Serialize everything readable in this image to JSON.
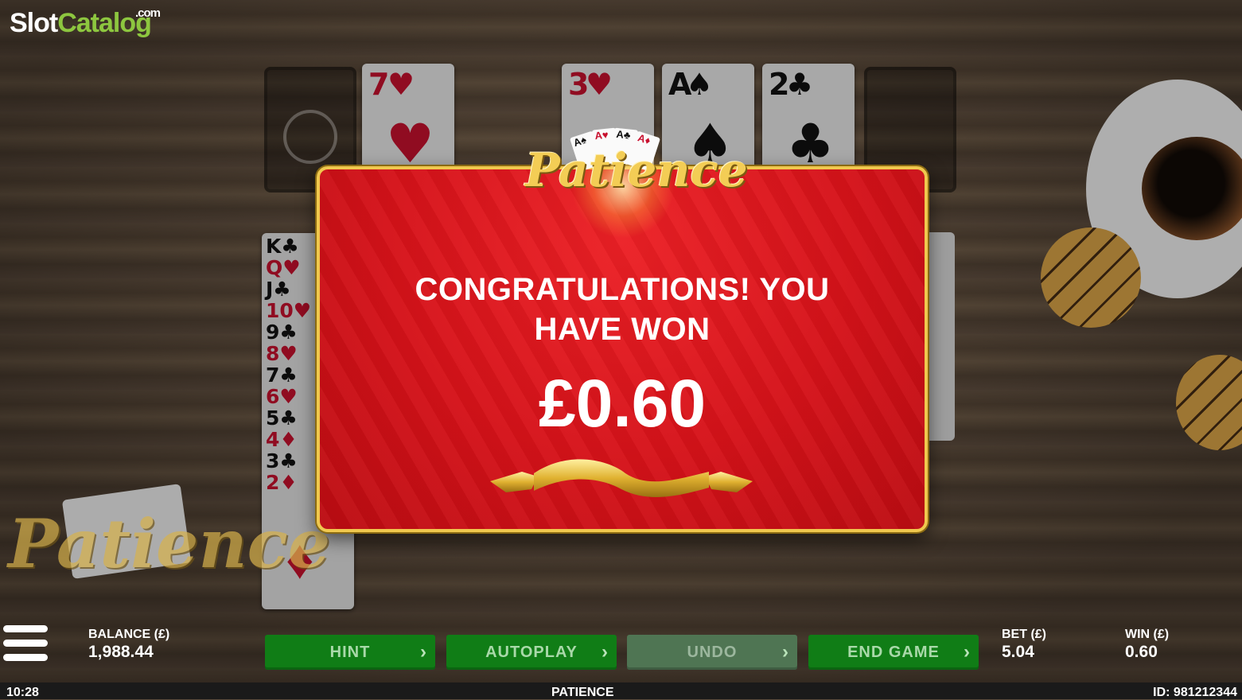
{
  "brand": {
    "word1": "Slot",
    "word2": "Catalog",
    "suffix": ".com"
  },
  "cards": {
    "seven_hearts": {
      "rank": "7",
      "suit": "♥"
    },
    "three_hearts": {
      "rank": "3",
      "suit": "♥"
    },
    "ace_spades": {
      "rank": "A",
      "suit": "♠"
    },
    "two_clubs": {
      "rank": "2",
      "suit": "♣"
    }
  },
  "tableau": [
    {
      "label": "K♣",
      "color": "blk"
    },
    {
      "label": "Q♥",
      "color": "red"
    },
    {
      "label": "J♣",
      "color": "blk"
    },
    {
      "label": "10♥",
      "color": "red"
    },
    {
      "label": "9♣",
      "color": "blk"
    },
    {
      "label": "8♥",
      "color": "red"
    },
    {
      "label": "7♣",
      "color": "blk"
    },
    {
      "label": "6♥",
      "color": "red"
    },
    {
      "label": "5♣",
      "color": "blk"
    },
    {
      "label": "4♦",
      "color": "red"
    },
    {
      "label": "3♣",
      "color": "blk"
    },
    {
      "label": "2♦",
      "color": "red"
    }
  ],
  "popup": {
    "logo_text": "Patience",
    "logo_cards": [
      "A♠",
      "A♥",
      "A♣",
      "A♦"
    ],
    "message_line1": "CONGRATULATIONS! YOU",
    "message_line2": "HAVE WON",
    "amount": "£0.60"
  },
  "side_logo_text": "Patience",
  "balance": {
    "label": "BALANCE (£)",
    "value": "1,988.44"
  },
  "bet": {
    "label": "BET (£)",
    "value": "5.04"
  },
  "win": {
    "label": "WIN (£)",
    "value": "0.60"
  },
  "buttons": {
    "hint": "HINT",
    "autoplay": "AUTOPLAY",
    "undo": "UNDO",
    "end_game": "END GAME",
    "arrow": "›"
  },
  "footer": {
    "time": "10:28",
    "game": "PATIENCE",
    "id": "ID: 981212344"
  },
  "colors": {
    "popup_red": "#d51219",
    "gold": "#f0c84e",
    "button_green": "#107d16"
  }
}
